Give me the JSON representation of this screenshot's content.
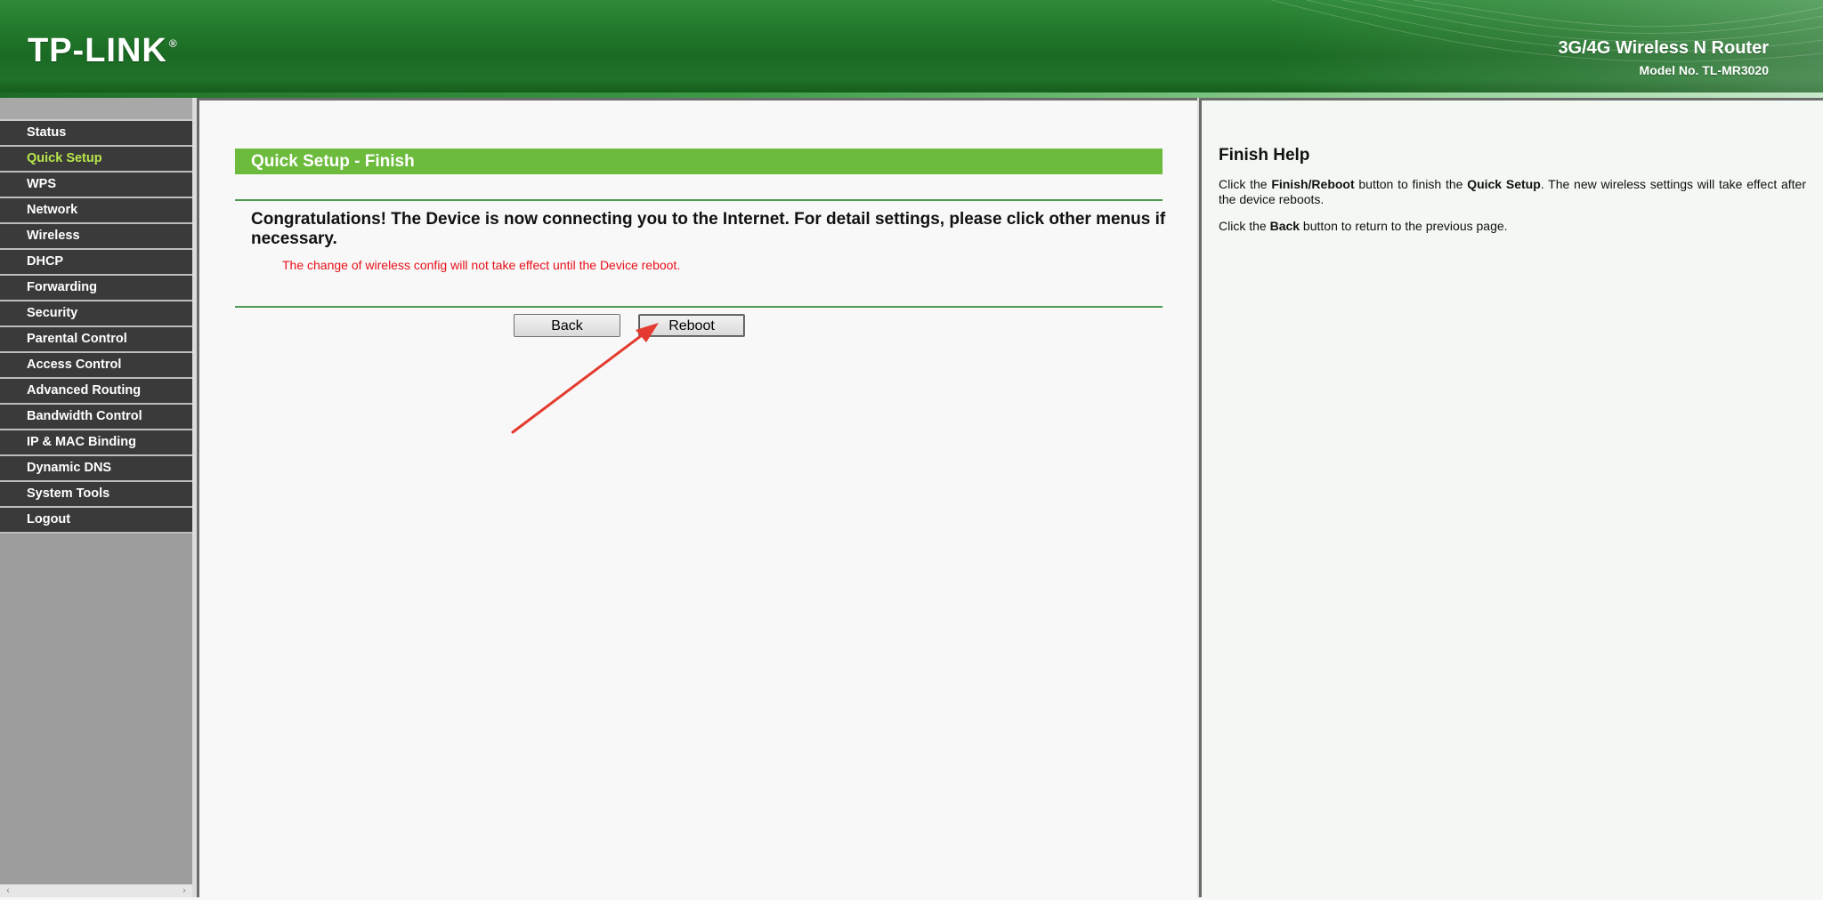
{
  "header": {
    "logo_text": "TP-LINK",
    "logo_mark": "®",
    "product_name": "3G/4G Wireless N Router",
    "model": "Model No. TL-MR3020"
  },
  "sidebar": {
    "items": [
      {
        "label": "Status",
        "active": false
      },
      {
        "label": "Quick Setup",
        "active": true
      },
      {
        "label": "WPS",
        "active": false
      },
      {
        "label": "Network",
        "active": false
      },
      {
        "label": "Wireless",
        "active": false
      },
      {
        "label": "DHCP",
        "active": false
      },
      {
        "label": "Forwarding",
        "active": false
      },
      {
        "label": "Security",
        "active": false
      },
      {
        "label": "Parental Control",
        "active": false
      },
      {
        "label": "Access Control",
        "active": false
      },
      {
        "label": "Advanced Routing",
        "active": false
      },
      {
        "label": "Bandwidth Control",
        "active": false
      },
      {
        "label": "IP & MAC Binding",
        "active": false
      },
      {
        "label": "Dynamic DNS",
        "active": false
      },
      {
        "label": "System Tools",
        "active": false
      },
      {
        "label": "Logout",
        "active": false
      }
    ]
  },
  "main": {
    "title": "Quick Setup - Finish",
    "congrats": "Congratulations! The Device is now connecting you to the Internet. For detail settings, please click other menus if necessary.",
    "note": "The change of wireless config will not take effect until the Device reboot.",
    "back_label": "Back",
    "reboot_label": "Reboot"
  },
  "help": {
    "title": "Finish Help",
    "p1_a": "Click the ",
    "p1_b": "Finish/Reboot",
    "p1_c": " button to finish the ",
    "p1_d": "Quick Setup",
    "p1_e": ". The new wireless settings will take effect after the device reboots.",
    "p2_a": "Click the ",
    "p2_b": "Back",
    "p2_c": " button to return to the previous page."
  },
  "colors": {
    "header_green": "#1f7229",
    "title_bar_green": "#6cbb3c",
    "menu_bg": "#3a3a3a",
    "menu_active": "#b8e64a",
    "note_red": "#e8111a",
    "annotation_arrow": "#e53a2f"
  }
}
